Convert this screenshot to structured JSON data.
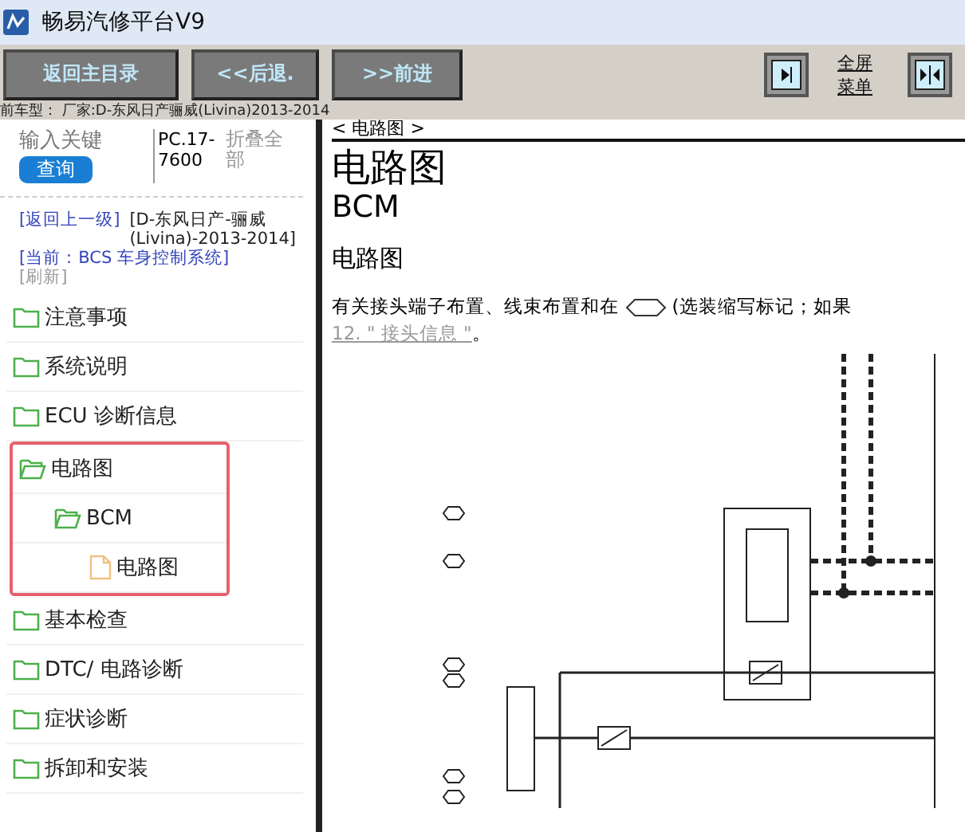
{
  "window": {
    "title": "畅易汽修平台V9"
  },
  "toolbar": {
    "buttons": [
      "返回主目录",
      "<<后退.",
      ">>前进"
    ],
    "fullscreen_menu": "全屏菜单"
  },
  "vehicle_info": "前车型： 厂家:D-东风日产骊威(Livina)2013-2014",
  "sidebar": {
    "search": {
      "placeholder": "输入关键"
    },
    "search_button": "查询",
    "code": "PC.17-7600",
    "collapse_all": "折叠全部",
    "nav_links": [
      {
        "text": "[返回上一级]",
        "kind": "link"
      },
      {
        "text": "[D-东风日产-骊威(Livina)-2013-2014]",
        "kind": "plain"
      },
      {
        "text": "[当前：BCS 车身控制系统]",
        "kind": "link"
      },
      {
        "text": "[刷新]",
        "kind": "muted"
      }
    ],
    "tree": [
      {
        "label": "注意事项",
        "kind": "folder",
        "expanded": false,
        "highlighted": false
      },
      {
        "label": "系统说明",
        "kind": "folder",
        "expanded": false,
        "highlighted": false
      },
      {
        "label": "ECU 诊断信息",
        "kind": "folder",
        "expanded": false,
        "highlighted": false
      },
      {
        "label": "电路图",
        "kind": "folder",
        "expanded": true,
        "highlighted": true,
        "children": [
          {
            "label": "BCM",
            "kind": "folder",
            "expanded": true,
            "children": [
              {
                "label": "电路图",
                "kind": "file"
              }
            ]
          }
        ]
      },
      {
        "label": "基本检查",
        "kind": "folder",
        "expanded": false,
        "highlighted": false
      },
      {
        "label": "DTC/ 电路诊断",
        "kind": "folder",
        "expanded": false,
        "highlighted": false
      },
      {
        "label": "症状诊断",
        "kind": "folder",
        "expanded": false,
        "highlighted": false
      },
      {
        "label": "拆卸和安装",
        "kind": "folder",
        "expanded": false,
        "highlighted": false
      }
    ]
  },
  "content": {
    "breadcrumb": "< 电路图 >",
    "title": "电路图",
    "subtitle": "BCM",
    "section": "电路图",
    "paragraph_start": "有关接头端子布置、线束布置和在",
    "paragraph_end": "(选装缩写标记；如果",
    "link": "12. \" 接头信息 \"",
    "link_after": "。"
  }
}
